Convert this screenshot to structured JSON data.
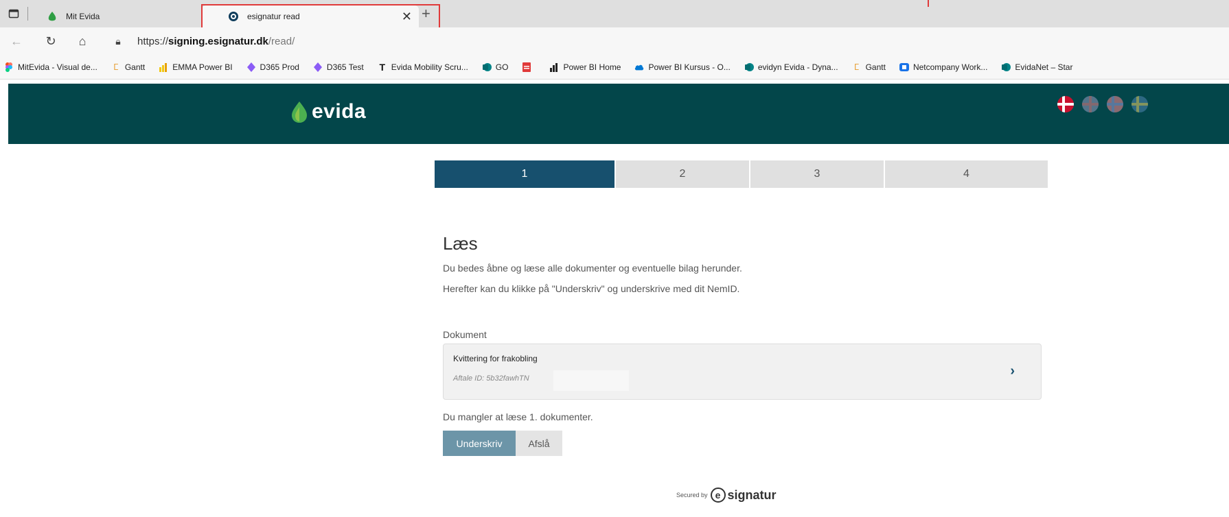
{
  "browser": {
    "tabs": [
      {
        "title": "Mit Evida",
        "icon": "evida-leaf-icon"
      },
      {
        "title": "esignatur read",
        "icon": "esignatur-icon"
      }
    ],
    "url": {
      "scheme": "https://",
      "host": "signing.esignatur.dk",
      "path": "/read/"
    },
    "bookmarks": [
      {
        "label": "MitEvida - Visual de...",
        "icon": "figma-icon"
      },
      {
        "label": "Gantt",
        "icon": "gantt-icon"
      },
      {
        "label": "EMMA Power BI",
        "icon": "powerbi-icon"
      },
      {
        "label": "D365 Prod",
        "icon": "d365-icon"
      },
      {
        "label": "D365 Test",
        "icon": "d365-icon"
      },
      {
        "label": "Evida Mobility Scru...",
        "icon": "t-icon"
      },
      {
        "label": "GO",
        "icon": "sharepoint-icon"
      },
      {
        "label": "",
        "icon": "pdf-icon"
      },
      {
        "label": "Power BI Home",
        "icon": "chart-icon"
      },
      {
        "label": "Power BI Kursus - O...",
        "icon": "cloud-icon"
      },
      {
        "label": "evidyn Evida - Dyna...",
        "icon": "sharepoint-icon"
      },
      {
        "label": "Gantt",
        "icon": "gantt-icon"
      },
      {
        "label": "Netcompany Work...",
        "icon": "netcompany-icon"
      },
      {
        "label": "EvidaNet – Star",
        "icon": "sharepoint-icon"
      }
    ]
  },
  "site": {
    "logo_text": "evida",
    "languages": [
      "da",
      "en",
      "no",
      "se"
    ]
  },
  "steps": [
    "1",
    "2",
    "3",
    "4"
  ],
  "active_step": 1,
  "content": {
    "title": "Læs",
    "paragraph1": "Du bedes åbne og læse alle dokumenter og eventuelle bilag herunder.",
    "paragraph2": "Herefter kan du klikke på \"Underskriv\" og underskrive med dit NemID.",
    "document_label": "Dokument",
    "document": {
      "title": "Kvittering for frakobling",
      "id_text": "Aftale ID: 5b32fawhTN"
    },
    "missing_text": "Du mangler at læse 1. dokumenter.",
    "sign_button": "Underskriv",
    "decline_button": "Afslå"
  },
  "footer": {
    "secured_by": "Secured by",
    "brand_letter": "e",
    "brand": "signatur"
  },
  "colors": {
    "header_bg": "#03464a",
    "active_step": "#17506e",
    "sign_button": "#6c95a8",
    "highlight": "#e03a3a"
  }
}
